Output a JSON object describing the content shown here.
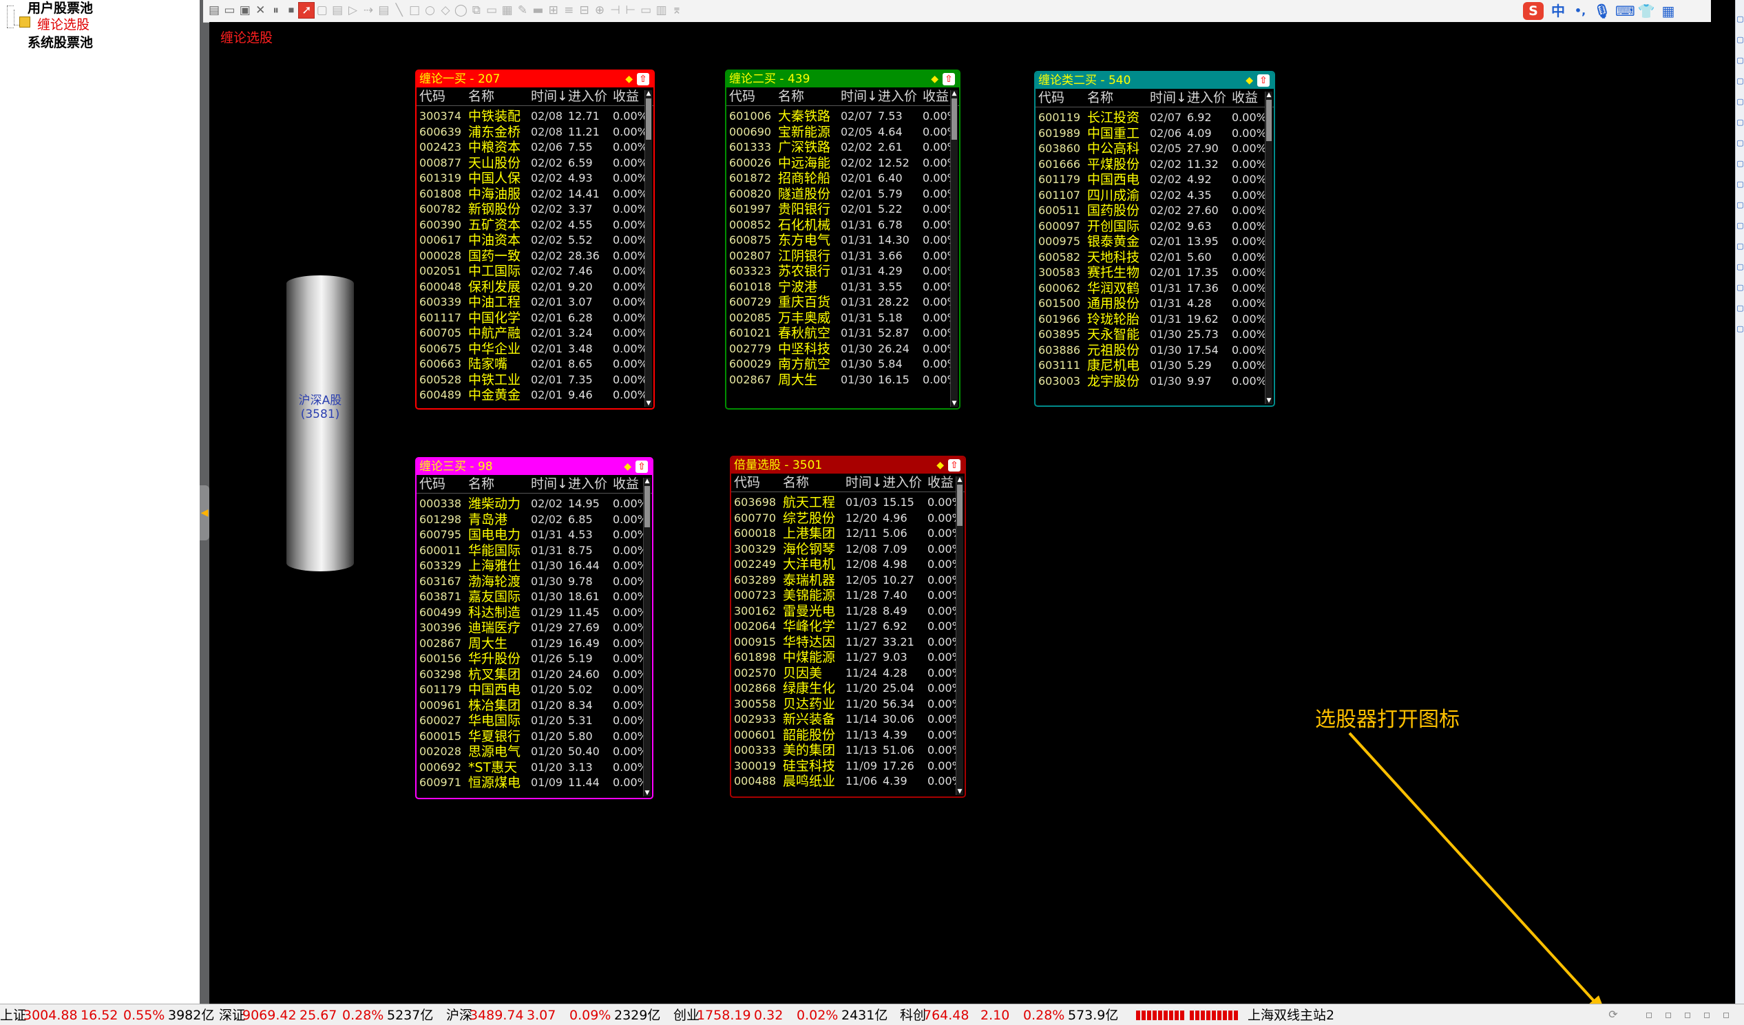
{
  "tree": {
    "items": [
      {
        "label": "用户股票池"
      },
      {
        "label": "缠论选股"
      },
      {
        "label": "系统股票池"
      }
    ]
  },
  "canvas": {
    "title": "缠论选股"
  },
  "pool": {
    "name": "沪深A股",
    "count": "(3581)"
  },
  "columns": {
    "code": "代码",
    "name": "名称",
    "time": "时间↓",
    "price": "进入价",
    "ret": "收益"
  },
  "panels": [
    {
      "title": "缠论一买 - 207",
      "color": "#ff0000",
      "rows": [
        [
          "300374",
          "中铁装配",
          "02/08",
          "12.71",
          "0.00%"
        ],
        [
          "600639",
          "浦东金桥",
          "02/08",
          "11.21",
          "0.00%"
        ],
        [
          "002423",
          "中粮资本",
          "02/06",
          "7.55",
          "0.00%"
        ],
        [
          "000877",
          "天山股份",
          "02/02",
          "6.59",
          "0.00%"
        ],
        [
          "601319",
          "中国人保",
          "02/02",
          "4.93",
          "0.00%"
        ],
        [
          "601808",
          "中海油服",
          "02/02",
          "14.41",
          "0.00%"
        ],
        [
          "600782",
          "新钢股份",
          "02/02",
          "3.37",
          "0.00%"
        ],
        [
          "600390",
          "五矿资本",
          "02/02",
          "4.55",
          "0.00%"
        ],
        [
          "000617",
          "中油资本",
          "02/02",
          "5.52",
          "0.00%"
        ],
        [
          "000028",
          "国药一致",
          "02/02",
          "28.36",
          "0.00%"
        ],
        [
          "002051",
          "中工国际",
          "02/02",
          "7.46",
          "0.00%"
        ],
        [
          "600048",
          "保利发展",
          "02/01",
          "9.20",
          "0.00%"
        ],
        [
          "600339",
          "中油工程",
          "02/01",
          "3.07",
          "0.00%"
        ],
        [
          "601117",
          "中国化学",
          "02/01",
          "6.28",
          "0.00%"
        ],
        [
          "600705",
          "中航产融",
          "02/01",
          "3.24",
          "0.00%"
        ],
        [
          "600675",
          "中华企业",
          "02/01",
          "3.48",
          "0.00%"
        ],
        [
          "600663",
          "陆家嘴",
          "02/01",
          "8.65",
          "0.00%"
        ],
        [
          "600528",
          "中铁工业",
          "02/01",
          "7.35",
          "0.00%"
        ],
        [
          "600489",
          "中金黄金",
          "02/01",
          "9.46",
          "0.00%"
        ]
      ]
    },
    {
      "title": "缠论二买 - 439",
      "color": "#008f00",
      "rows": [
        [
          "601006",
          "大秦铁路",
          "02/07",
          "7.53",
          "0.00%"
        ],
        [
          "000690",
          "宝新能源",
          "02/05",
          "4.64",
          "0.00%"
        ],
        [
          "601333",
          "广深铁路",
          "02/02",
          "2.61",
          "0.00%"
        ],
        [
          "600026",
          "中远海能",
          "02/02",
          "12.52",
          "0.00%"
        ],
        [
          "601872",
          "招商轮船",
          "02/01",
          "6.40",
          "0.00%"
        ],
        [
          "600820",
          "隧道股份",
          "02/01",
          "5.79",
          "0.00%"
        ],
        [
          "601997",
          "贵阳银行",
          "02/01",
          "5.22",
          "0.00%"
        ],
        [
          "000852",
          "石化机械",
          "01/31",
          "6.78",
          "0.00%"
        ],
        [
          "600875",
          "东方电气",
          "01/31",
          "14.30",
          "0.00%"
        ],
        [
          "002807",
          "江阴银行",
          "01/31",
          "3.66",
          "0.00%"
        ],
        [
          "603323",
          "苏农银行",
          "01/31",
          "4.29",
          "0.00%"
        ],
        [
          "601018",
          "宁波港",
          "01/31",
          "3.55",
          "0.00%"
        ],
        [
          "600729",
          "重庆百货",
          "01/31",
          "28.22",
          "0.00%"
        ],
        [
          "002085",
          "万丰奥威",
          "01/31",
          "5.18",
          "0.00%"
        ],
        [
          "601021",
          "春秋航空",
          "01/31",
          "52.87",
          "0.00%"
        ],
        [
          "002779",
          "中坚科技",
          "01/30",
          "26.24",
          "0.00%"
        ],
        [
          "600029",
          "南方航空",
          "01/30",
          "5.84",
          "0.00%"
        ],
        [
          "002867",
          "周大生",
          "01/30",
          "16.15",
          "0.00%"
        ]
      ]
    },
    {
      "title": "缠论类二买 - 540",
      "color": "#008b8b",
      "rows": [
        [
          "600119",
          "长江投资",
          "02/07",
          "6.92",
          "0.00%"
        ],
        [
          "601989",
          "中国重工",
          "02/06",
          "4.09",
          "0.00%"
        ],
        [
          "603860",
          "中公高科",
          "02/05",
          "27.90",
          "0.00%"
        ],
        [
          "601666",
          "平煤股份",
          "02/02",
          "11.32",
          "0.00%"
        ],
        [
          "601179",
          "中国西电",
          "02/02",
          "4.92",
          "0.00%"
        ],
        [
          "601107",
          "四川成渝",
          "02/02",
          "4.35",
          "0.00%"
        ],
        [
          "600511",
          "国药股份",
          "02/02",
          "27.60",
          "0.00%"
        ],
        [
          "600097",
          "开创国际",
          "02/02",
          "9.63",
          "0.00%"
        ],
        [
          "000975",
          "银泰黄金",
          "02/01",
          "13.95",
          "0.00%"
        ],
        [
          "600582",
          "天地科技",
          "02/01",
          "5.60",
          "0.00%"
        ],
        [
          "300583",
          "赛托生物",
          "02/01",
          "17.35",
          "0.00%"
        ],
        [
          "600062",
          "华润双鹤",
          "01/31",
          "17.36",
          "0.00%"
        ],
        [
          "601500",
          "通用股份",
          "01/31",
          "4.28",
          "0.00%"
        ],
        [
          "601966",
          "玲珑轮胎",
          "01/31",
          "19.62",
          "0.00%"
        ],
        [
          "603895",
          "天永智能",
          "01/30",
          "25.73",
          "0.00%"
        ],
        [
          "603886",
          "元祖股份",
          "01/30",
          "17.54",
          "0.00%"
        ],
        [
          "603111",
          "康尼机电",
          "01/30",
          "5.29",
          "0.00%"
        ],
        [
          "603003",
          "龙宇股份",
          "01/30",
          "9.97",
          "0.00%"
        ]
      ]
    },
    {
      "title": "缠论三买 - 98",
      "color": "#ff00ff",
      "rows": [
        [
          "000338",
          "潍柴动力",
          "02/02",
          "14.95",
          "0.00%"
        ],
        [
          "601298",
          "青岛港",
          "02/02",
          "6.85",
          "0.00%"
        ],
        [
          "600795",
          "国电电力",
          "01/31",
          "4.53",
          "0.00%"
        ],
        [
          "600011",
          "华能国际",
          "01/31",
          "8.75",
          "0.00%"
        ],
        [
          "603329",
          "上海雅仕",
          "01/30",
          "16.44",
          "0.00%"
        ],
        [
          "603167",
          "渤海轮渡",
          "01/30",
          "9.78",
          "0.00%"
        ],
        [
          "603871",
          "嘉友国际",
          "01/30",
          "18.61",
          "0.00%"
        ],
        [
          "600499",
          "科达制造",
          "01/29",
          "11.45",
          "0.00%"
        ],
        [
          "300396",
          "迪瑞医疗",
          "01/29",
          "27.69",
          "0.00%"
        ],
        [
          "002867",
          "周大生",
          "01/29",
          "16.49",
          "0.00%"
        ],
        [
          "600156",
          "华升股份",
          "01/26",
          "5.19",
          "0.00%"
        ],
        [
          "603298",
          "杭叉集团",
          "01/20",
          "24.60",
          "0.00%"
        ],
        [
          "601179",
          "中国西电",
          "01/20",
          "5.02",
          "0.00%"
        ],
        [
          "000961",
          "株冶集团",
          "01/20",
          "8.34",
          "0.00%"
        ],
        [
          "600027",
          "华电国际",
          "01/20",
          "5.31",
          "0.00%"
        ],
        [
          "600015",
          "华夏银行",
          "01/20",
          "5.80",
          "0.00%"
        ],
        [
          "002028",
          "思源电气",
          "01/20",
          "50.40",
          "0.00%"
        ],
        [
          "000692",
          "*ST惠天",
          "01/20",
          "3.13",
          "0.00%"
        ],
        [
          "600971",
          "恒源煤电",
          "01/09",
          "11.44",
          "0.00%"
        ]
      ]
    },
    {
      "title": "倍量选股 - 3501",
      "color": "#a80000",
      "rows": [
        [
          "603698",
          "航天工程",
          "01/03",
          "15.15",
          "0.00%"
        ],
        [
          "600770",
          "综艺股份",
          "12/20",
          "4.96",
          "0.00%"
        ],
        [
          "600018",
          "上港集团",
          "12/11",
          "5.06",
          "0.00%"
        ],
        [
          "300329",
          "海伦钢琴",
          "12/08",
          "7.09",
          "0.00%"
        ],
        [
          "002249",
          "大洋电机",
          "12/08",
          "4.98",
          "0.00%"
        ],
        [
          "603289",
          "泰瑞机器",
          "12/05",
          "10.27",
          "0.00%"
        ],
        [
          "000723",
          "美锦能源",
          "11/28",
          "7.40",
          "0.00%"
        ],
        [
          "300162",
          "雷曼光电",
          "11/28",
          "8.49",
          "0.00%"
        ],
        [
          "002064",
          "华峰化学",
          "11/27",
          "6.92",
          "0.00%"
        ],
        [
          "000915",
          "华特达因",
          "11/27",
          "33.21",
          "0.00%"
        ],
        [
          "601898",
          "中煤能源",
          "11/27",
          "9.03",
          "0.00%"
        ],
        [
          "002570",
          "贝因美",
          "11/24",
          "4.28",
          "0.00%"
        ],
        [
          "002868",
          "绿康生化",
          "11/20",
          "25.04",
          "0.00%"
        ],
        [
          "300558",
          "贝达药业",
          "11/20",
          "56.34",
          "0.00%"
        ],
        [
          "002933",
          "新兴装备",
          "11/14",
          "30.06",
          "0.00%"
        ],
        [
          "000601",
          "韶能股份",
          "11/13",
          "4.39",
          "0.00%"
        ],
        [
          "000333",
          "美的集团",
          "11/13",
          "51.06",
          "0.00%"
        ],
        [
          "300019",
          "硅宝科技",
          "11/09",
          "17.26",
          "0.00%"
        ],
        [
          "000488",
          "晨鸣纸业",
          "11/06",
          "4.39",
          "0.00%"
        ]
      ]
    }
  ],
  "annotation": {
    "text": "选股器打开图标"
  },
  "status": {
    "sh": {
      "label": "上证",
      "index": "3004.88",
      "chg": "16.52",
      "pct": "0.55%",
      "vol": "3982亿"
    },
    "sz": {
      "label": "深证",
      "index": "9069.42",
      "chg": "25.67",
      "pct": "0.28%",
      "vol": "5237亿"
    },
    "hs": {
      "label": "沪深",
      "index": "3489.74",
      "chg": "3.07",
      "pct": "0.09%",
      "vol": "2329亿"
    },
    "cy": {
      "label": "创业",
      "index": "1758.19",
      "chg": "0.32",
      "pct": "0.02%",
      "vol": "2431亿"
    },
    "kc": {
      "label": "科创",
      "index": "764.48",
      "chg": "2.10",
      "pct": "0.28%",
      "vol": "573.9亿"
    },
    "server": "上海双线主站2"
  },
  "ime": {
    "s_icon": "S",
    "lang": "中"
  },
  "icons": {
    "toolbar": [
      "document-icon",
      "folder-icon",
      "save-icon",
      "close-icon",
      "pause-icon",
      "stop-icon",
      "pointer-icon",
      "rect-icon",
      "window-icon",
      "play-icon",
      "next-icon",
      "list-icon",
      "line-icon",
      "box-icon",
      "circle-icon",
      "diamond-icon",
      "ring-icon",
      "copy-icon",
      "page-icon",
      "layout-icon",
      "brush-icon",
      "minus-icon",
      "grid-icon",
      "align-icon",
      "tree-icon",
      "branch-icon",
      "split-icon",
      "merge-icon",
      "panel-icon",
      "sheet-icon",
      "chart-icon"
    ],
    "opener": "stock-selector-open-icon"
  }
}
